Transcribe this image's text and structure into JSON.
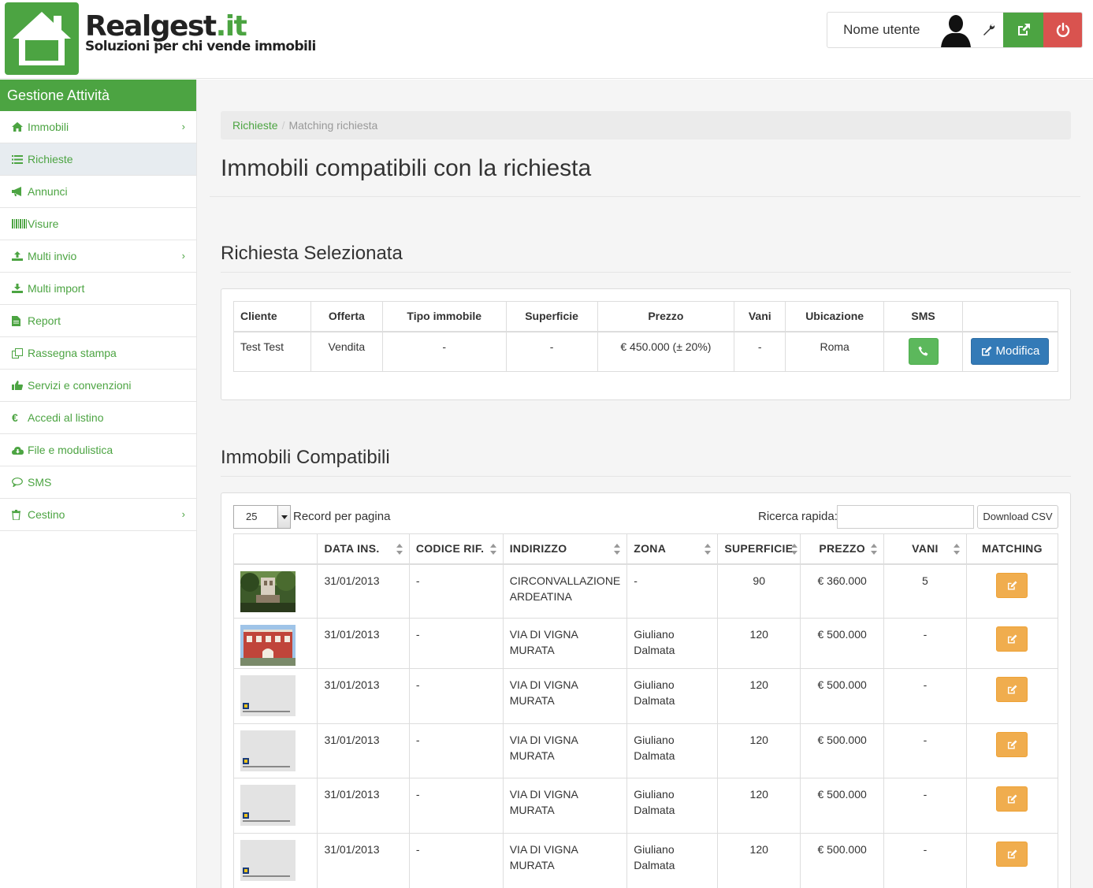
{
  "brand": {
    "name_part1": "Realgest",
    "name_part2": ".it",
    "tagline": "Soluzioni per chi vende immobili"
  },
  "user": {
    "name": "Nome utente"
  },
  "sidebar": {
    "title": "Gestione Attività",
    "items": [
      {
        "label": "Immobili",
        "icon": "home-icon",
        "chevron": true
      },
      {
        "label": "Richieste",
        "icon": "list-icon",
        "active": true
      },
      {
        "label": "Annunci",
        "icon": "bullhorn-icon"
      },
      {
        "label": "Visure",
        "icon": "barcode-icon"
      },
      {
        "label": "Multi invio",
        "icon": "upload-icon",
        "chevron": true
      },
      {
        "label": "Multi import",
        "icon": "download-icon"
      },
      {
        "label": "Report",
        "icon": "file-icon"
      },
      {
        "label": "Rassegna stampa",
        "icon": "copy-icon"
      },
      {
        "label": "Servizi e convenzioni",
        "icon": "thumbs-up-icon"
      },
      {
        "label": "Accedi al listino",
        "icon": "euro-icon"
      },
      {
        "label": "File e modulistica",
        "icon": "cloud-download-icon"
      },
      {
        "label": "SMS",
        "icon": "comment-icon"
      },
      {
        "label": "Cestino",
        "icon": "trash-icon",
        "chevron": true
      }
    ]
  },
  "breadcrumb": {
    "link": "Richieste",
    "sep": "/",
    "current": "Matching richiesta"
  },
  "page_title": "Immobili compatibili con la richiesta",
  "request_section": {
    "title": "Richiesta Selezionata",
    "headers": [
      "Cliente",
      "Offerta",
      "Tipo immobile",
      "Superficie",
      "Prezzo",
      "Vani",
      "Ubicazione",
      "SMS",
      ""
    ],
    "row": {
      "cliente": "Test Test",
      "offerta": "Vendita",
      "tipo": "-",
      "superficie": "-",
      "prezzo": "€ 450.000 (± 20%)",
      "vani": "-",
      "ubicazione": "Roma"
    },
    "edit_label": "Modifica"
  },
  "compat_section": {
    "title": "Immobili Compatibili",
    "page_size": "25",
    "rpp_label": "Record per pagina",
    "quick_search_label": "Ricerca rapida:",
    "csv_label": "Download CSV",
    "headers": [
      "",
      "DATA INS.",
      "CODICE RIF.",
      "INDIRIZZO",
      "ZONA",
      "SUPERFICIE",
      "PREZZO",
      "VANI",
      "MATCHING"
    ],
    "rows": [
      {
        "thumb": "garden",
        "data": "31/01/2013",
        "codice": "-",
        "indirizzo": "CIRCONVALLAZIONE ARDEATINA",
        "zona": "-",
        "superficie": "90",
        "prezzo": "€ 360.000",
        "vani": "5"
      },
      {
        "thumb": "villa",
        "data": "31/01/2013",
        "codice": "-",
        "indirizzo": "VIA DI VIGNA MURATA",
        "zona": "Giuliano Dalmata",
        "superficie": "120",
        "prezzo": "€ 500.000",
        "vani": "-"
      },
      {
        "thumb": "placeholder",
        "data": "31/01/2013",
        "codice": "-",
        "indirizzo": "VIA DI VIGNA MURATA",
        "zona": "Giuliano Dalmata",
        "superficie": "120",
        "prezzo": "€ 500.000",
        "vani": "-"
      },
      {
        "thumb": "placeholder",
        "data": "31/01/2013",
        "codice": "-",
        "indirizzo": "VIA DI VIGNA MURATA",
        "zona": "Giuliano Dalmata",
        "superficie": "120",
        "prezzo": "€ 500.000",
        "vani": "-"
      },
      {
        "thumb": "placeholder",
        "data": "31/01/2013",
        "codice": "-",
        "indirizzo": "VIA DI VIGNA MURATA",
        "zona": "Giuliano Dalmata",
        "superficie": "120",
        "prezzo": "€ 500.000",
        "vani": "-"
      },
      {
        "thumb": "placeholder",
        "data": "31/01/2013",
        "codice": "-",
        "indirizzo": "VIA DI VIGNA MURATA",
        "zona": "Giuliano Dalmata",
        "superficie": "120",
        "prezzo": "€ 500.000",
        "vani": "-"
      }
    ]
  },
  "colors": {
    "brand_green": "#4ca442",
    "danger_red": "#d9534f",
    "primary_blue": "#337ab7",
    "warning_orange": "#f0ad4e",
    "success_green": "#5cb85c"
  }
}
